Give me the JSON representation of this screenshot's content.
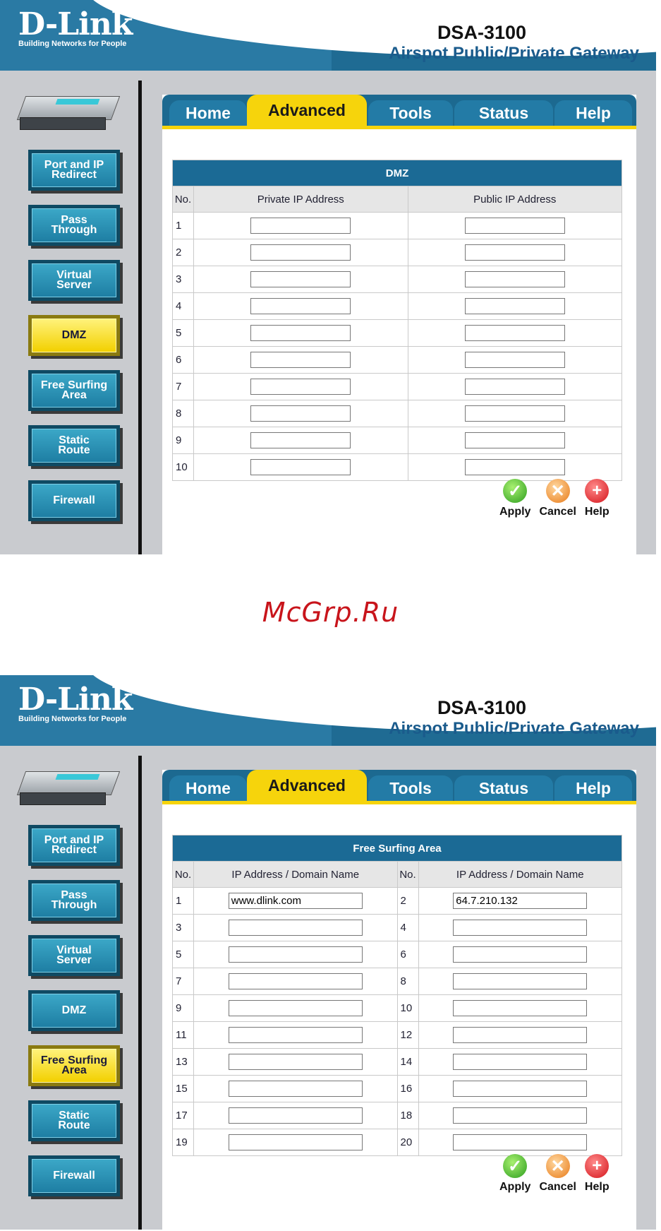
{
  "brand": {
    "logo": "D-Link",
    "tagline": "Building Networks for People"
  },
  "product": {
    "model": "DSA-3100",
    "description": "Airspot Public/Private Gateway"
  },
  "tabs": [
    "Home",
    "Advanced",
    "Tools",
    "Status",
    "Help"
  ],
  "sidebar": [
    "Port and IP\nRedirect",
    "Pass\nThrough",
    "Virtual\nServer",
    "DMZ",
    "Free Surfing\nArea",
    "Static\nRoute",
    "Firewall"
  ],
  "actions": {
    "apply": "Apply",
    "cancel": "Cancel",
    "help": "Help"
  },
  "watermark": "McGrp.Ru",
  "dmz": {
    "title": "DMZ",
    "col_no": "No.",
    "col_private": "Private IP Address",
    "col_public": "Public IP Address",
    "rows": [
      "1",
      "2",
      "3",
      "4",
      "5",
      "6",
      "7",
      "8",
      "9",
      "10"
    ]
  },
  "free_surfing": {
    "title": "Free Surfing Area",
    "col_no": "No.",
    "col_addr": "IP Address / Domain Name",
    "rows": [
      [
        "1",
        "www.dlink.com",
        "2",
        "64.7.210.132"
      ],
      [
        "3",
        "",
        "4",
        ""
      ],
      [
        "5",
        "",
        "6",
        ""
      ],
      [
        "7",
        "",
        "8",
        ""
      ],
      [
        "9",
        "",
        "10",
        ""
      ],
      [
        "11",
        "",
        "12",
        ""
      ],
      [
        "13",
        "",
        "14",
        ""
      ],
      [
        "15",
        "",
        "16",
        ""
      ],
      [
        "17",
        "",
        "18",
        ""
      ],
      [
        "19",
        "",
        "20",
        ""
      ]
    ]
  },
  "colors": {
    "header_blue": "#1f6b93",
    "tab_active": "#f6d40c",
    "table_header": "#1b6a95",
    "nav_active": "#f2d000"
  }
}
